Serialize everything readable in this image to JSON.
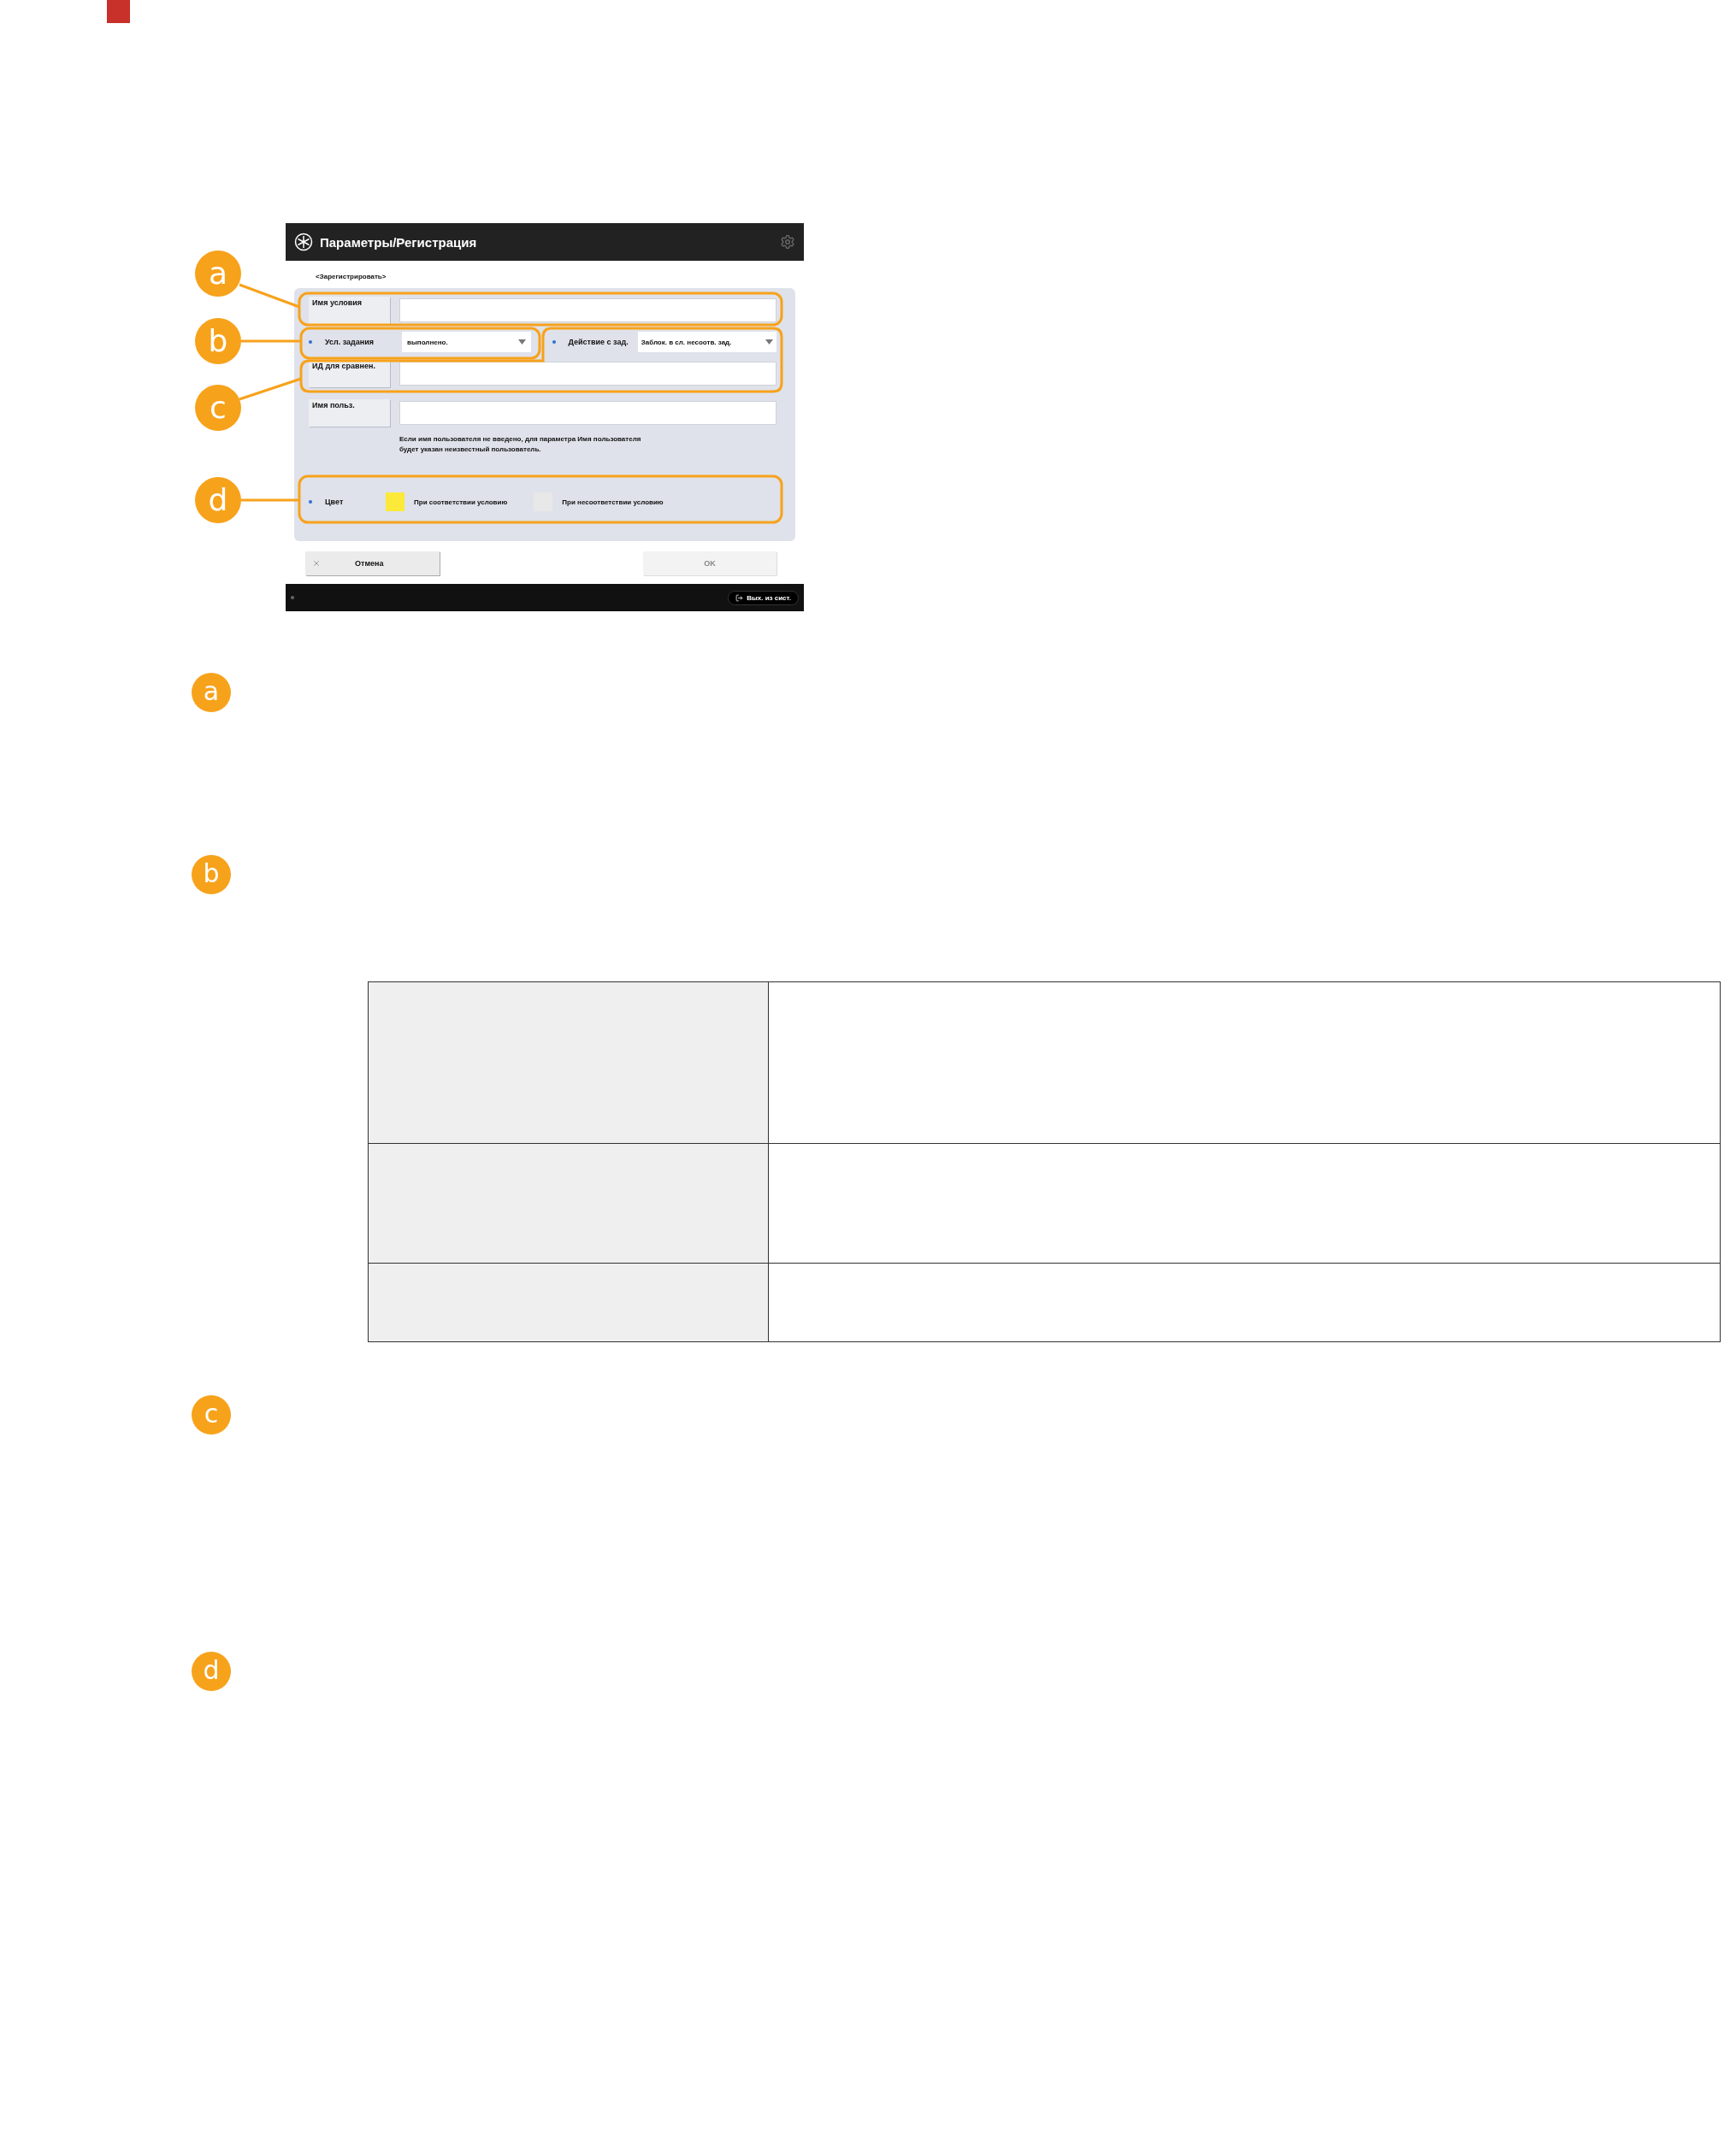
{
  "figure": {
    "screen": {
      "title": "Параметры/Регистрация",
      "subtitle": "<Зарегистрировать>",
      "name_field": {
        "label": "Имя условия"
      },
      "condition": {
        "label": "Усл. задания",
        "value": "выполнено."
      },
      "action": {
        "label": "Действие с зад.",
        "value": "Заблок. в сл. несоотв. зад."
      },
      "id_field": {
        "label": "ИД для сравнен."
      },
      "user_field": {
        "label": "Имя польз."
      },
      "hint": "Если имя пользователя не введено, для параметра Имя пользователя будет указан неизвестный пользователь.",
      "color": {
        "label": "Цвет",
        "options": [
          {
            "label": "При соответствии условию",
            "color": "#fde93a"
          },
          {
            "label": "При несоответствии условию",
            "color": "#e8e8e8"
          }
        ]
      },
      "buttons": [
        {
          "kind": "cancel",
          "label": "Отмена",
          "disabled": false
        },
        {
          "kind": "ok",
          "label": "OK",
          "disabled": true
        }
      ],
      "logout": "Вых. из сист."
    },
    "callouts": [
      "a",
      "b",
      "c",
      "d"
    ]
  },
  "sections": [
    {
      "badge": "a"
    },
    {
      "badge": "b"
    },
    {
      "badge": "c"
    },
    {
      "badge": "d"
    }
  ]
}
